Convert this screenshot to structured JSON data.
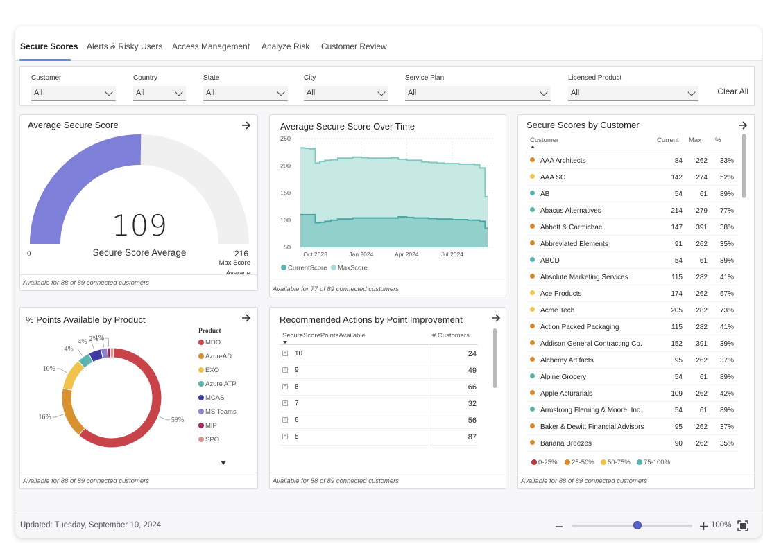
{
  "tabs": [
    "Secure Scores",
    "Alerts & Risky Users",
    "Access Management",
    "Analyze Risk",
    "Customer Review"
  ],
  "filters": [
    {
      "label": "Customer",
      "value": "All"
    },
    {
      "label": "Country",
      "value": "All"
    },
    {
      "label": "State",
      "value": "All"
    },
    {
      "label": "City",
      "value": "All"
    },
    {
      "label": "Service Plan",
      "value": "All"
    },
    {
      "label": "Licensed Product",
      "value": "All"
    }
  ],
  "clear_all": "Clear All",
  "gauge": {
    "title": "Average Secure Score",
    "value": "109",
    "label": "Secure Score Average",
    "min": "0",
    "max": "216",
    "max_label_1": "Max Score",
    "max_label_2": "Average",
    "fill_fraction": 0.5046,
    "fill_color": "#7d7fd8",
    "track_color": "#f0f0f0",
    "footer": "Available for 88 of 89 connected customers"
  },
  "trend": {
    "title": "Average Secure Score Over Time",
    "footer": "Available for 77 of 89 connected customers"
  },
  "donut": {
    "title": "% Points Available by Product",
    "legend_title": "Product",
    "footer": "Available for 88 of 89 connected customers"
  },
  "actions": {
    "title": "Recommended Actions by Point Improvement",
    "col1": "SecureScorePointsAvailable",
    "col2": "# Customers",
    "rows": [
      {
        "points": "10",
        "customers": "24"
      },
      {
        "points": "9",
        "customers": "49"
      },
      {
        "points": "8",
        "customers": "66"
      },
      {
        "points": "7",
        "customers": "32"
      },
      {
        "points": "6",
        "customers": "56"
      },
      {
        "points": "5",
        "customers": "87"
      }
    ],
    "footer": "Available for 88 of 89 connected customers"
  },
  "customers": {
    "title": "Secure Scores by Customer",
    "col_customer": "Customer",
    "col_current": "Current",
    "col_max": "Max",
    "col_pct": "%",
    "rows": [
      {
        "name": "AAA Architects",
        "current": "84",
        "max": "262",
        "pct": "33%",
        "band": "25-50%"
      },
      {
        "name": "AAA SC",
        "current": "142",
        "max": "274",
        "pct": "52%",
        "band": "50-75%"
      },
      {
        "name": "AB",
        "current": "54",
        "max": "61",
        "pct": "89%",
        "band": "75-100%"
      },
      {
        "name": "Abacus Alternatives",
        "current": "214",
        "max": "279",
        "pct": "77%",
        "band": "75-100%"
      },
      {
        "name": "Abbott & Carmichael",
        "current": "147",
        "max": "391",
        "pct": "38%",
        "band": "25-50%"
      },
      {
        "name": "Abbreviated Elements",
        "current": "91",
        "max": "262",
        "pct": "35%",
        "band": "25-50%"
      },
      {
        "name": "ABCD",
        "current": "54",
        "max": "61",
        "pct": "89%",
        "band": "75-100%"
      },
      {
        "name": "Absolute Marketing Services",
        "current": "115",
        "max": "282",
        "pct": "41%",
        "band": "25-50%"
      },
      {
        "name": "Ace Products",
        "current": "174",
        "max": "262",
        "pct": "67%",
        "band": "50-75%"
      },
      {
        "name": "Acme Tech",
        "current": "205",
        "max": "282",
        "pct": "73%",
        "band": "50-75%"
      },
      {
        "name": "Action Packed Packaging",
        "current": "115",
        "max": "282",
        "pct": "41%",
        "band": "25-50%"
      },
      {
        "name": "Addison General Contracting Co.",
        "current": "152",
        "max": "391",
        "pct": "39%",
        "band": "25-50%"
      },
      {
        "name": "Alchemy Artifacts",
        "current": "95",
        "max": "262",
        "pct": "37%",
        "band": "25-50%"
      },
      {
        "name": "Alpine Grocery",
        "current": "54",
        "max": "61",
        "pct": "89%",
        "band": "75-100%"
      },
      {
        "name": "Apple Acturarials",
        "current": "109",
        "max": "262",
        "pct": "42%",
        "band": "25-50%"
      },
      {
        "name": "Armstrong Fleming & Moore, Inc.",
        "current": "54",
        "max": "61",
        "pct": "89%",
        "band": "75-100%"
      },
      {
        "name": "Baker & Dewitt Financial Advisors",
        "current": "95",
        "max": "262",
        "pct": "37%",
        "band": "25-50%"
      },
      {
        "name": "Banana Breezes",
        "current": "90",
        "max": "262",
        "pct": "35%",
        "band": "25-50%"
      }
    ],
    "bands": [
      {
        "label": "0-25%",
        "color": "#c0393f"
      },
      {
        "label": "25-50%",
        "color": "#d88a2b"
      },
      {
        "label": "50-75%",
        "color": "#f0c44c"
      },
      {
        "label": "75-100%",
        "color": "#5cb3b0"
      }
    ],
    "footer": "Available for 88 of 89 connected customers"
  },
  "status": {
    "updated": "Updated: Tuesday, September 10, 2024",
    "zoom": "100%",
    "zoom_level": 0.5
  },
  "chart_data": [
    {
      "type": "area",
      "title": "Average Secure Score Over Time",
      "xlabel": "",
      "ylabel": "",
      "ylim": [
        50,
        250
      ],
      "yticks": [
        50,
        100,
        150,
        200,
        250
      ],
      "xticks": [
        "Oct 2023",
        "Jan 2024",
        "Apr 2024",
        "Jul 2024"
      ],
      "grid": true,
      "legend": "bottom-left",
      "x": [
        "2023-09-01",
        "2023-09-10",
        "2023-09-20",
        "2023-10-01",
        "2023-10-10",
        "2023-10-20",
        "2023-11-01",
        "2023-11-15",
        "2023-12-01",
        "2023-12-15",
        "2024-01-01",
        "2024-01-15",
        "2024-02-01",
        "2024-02-15",
        "2024-03-01",
        "2024-03-15",
        "2024-04-01",
        "2024-04-15",
        "2024-05-01",
        "2024-05-15",
        "2024-06-01",
        "2024-06-15",
        "2024-07-01",
        "2024-07-15",
        "2024-08-01",
        "2024-08-15",
        "2024-08-25",
        "2024-09-05",
        "2024-09-10"
      ],
      "series": [
        {
          "name": "CurrentScore",
          "color": "#5cb3b0",
          "values": [
            110,
            110,
            110,
            95,
            96,
            98,
            100,
            102,
            102,
            104,
            104,
            104,
            104,
            104,
            104,
            106,
            105,
            104,
            104,
            103,
            102,
            102,
            101,
            101,
            100,
            100,
            98,
            85,
            85
          ]
        },
        {
          "name": "MaxScore",
          "color": "#a8dcd6",
          "values": [
            233,
            232,
            231,
            205,
            208,
            210,
            211,
            214,
            214,
            216,
            215,
            214,
            214,
            214,
            215,
            212,
            210,
            210,
            207,
            206,
            205,
            204,
            204,
            203,
            203,
            202,
            196,
            143,
            143
          ]
        }
      ]
    },
    {
      "type": "pie",
      "title": "% Points Available by Product",
      "legend": "right",
      "categories": [
        "MDO",
        "AzureAD",
        "EXO",
        "Azure ATP",
        "MCAS",
        "MS Teams",
        "MIP",
        "SPO"
      ],
      "values": [
        59,
        16,
        10,
        4,
        4,
        2,
        1,
        1
      ],
      "slice_labels": [
        "59%",
        "16%",
        "10%",
        "4%",
        "4%",
        "2%",
        "1%",
        ""
      ],
      "colors": [
        "#c9444a",
        "#d8912f",
        "#f0c44c",
        "#5cb3b0",
        "#3d3aa0",
        "#8d82c9",
        "#a0285e",
        "#d49890"
      ]
    }
  ]
}
